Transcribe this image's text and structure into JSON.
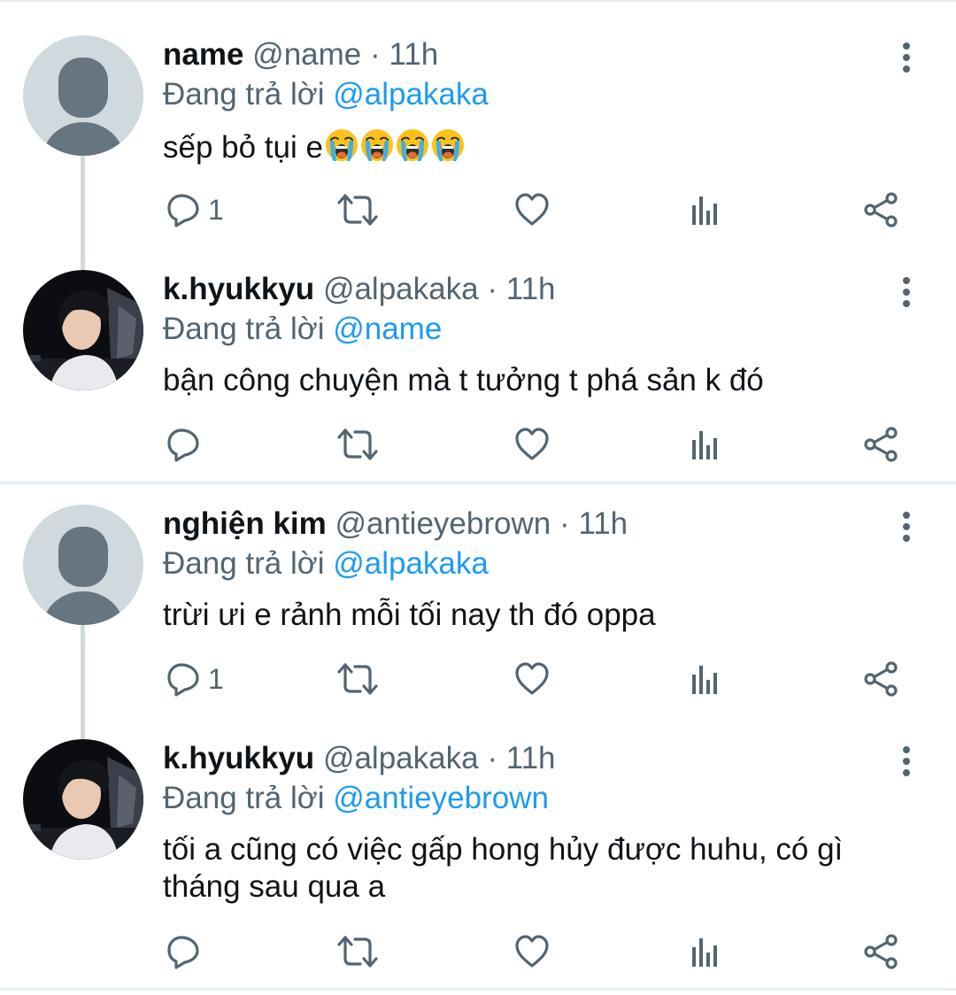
{
  "reply_prefix": "Đang trả lời ",
  "separator": "·",
  "colors": {
    "mention": "#1d9bf0",
    "secondary_text": "#536471",
    "divider": "#e6ecf0",
    "thread_line": "#cfd9de"
  },
  "icons": [
    "reply-icon",
    "retweet-icon",
    "like-icon",
    "analytics-icon",
    "share-icon",
    "more-icon"
  ],
  "tweets": [
    {
      "name": "name",
      "handle": "@name",
      "time": "11h",
      "reply_to": "@alpakaka",
      "text": "sếp bỏ tụi e",
      "emojis": "😭😭😭😭",
      "reply_count": "1"
    },
    {
      "name": "k.hyukkyu",
      "handle": "@alpakaka",
      "time": "11h",
      "reply_to": "@name",
      "text": "bận công chuyện mà t tưởng t phá sản k đó",
      "reply_count": ""
    },
    {
      "name": "nghiện kim",
      "handle": "@antieyebrown",
      "time": "11h",
      "reply_to": "@alpakaka",
      "text": "trừi ưi e rảnh mỗi tối nay th đó oppa",
      "reply_count": "1"
    },
    {
      "name": "k.hyukkyu",
      "handle": "@alpakaka",
      "time": "11h",
      "reply_to": "@antieyebrown",
      "text_line1": "tối a cũng có việc gấp hong hủy được huhu, có gì",
      "text_line2": "tháng sau qua a",
      "reply_count": ""
    }
  ]
}
